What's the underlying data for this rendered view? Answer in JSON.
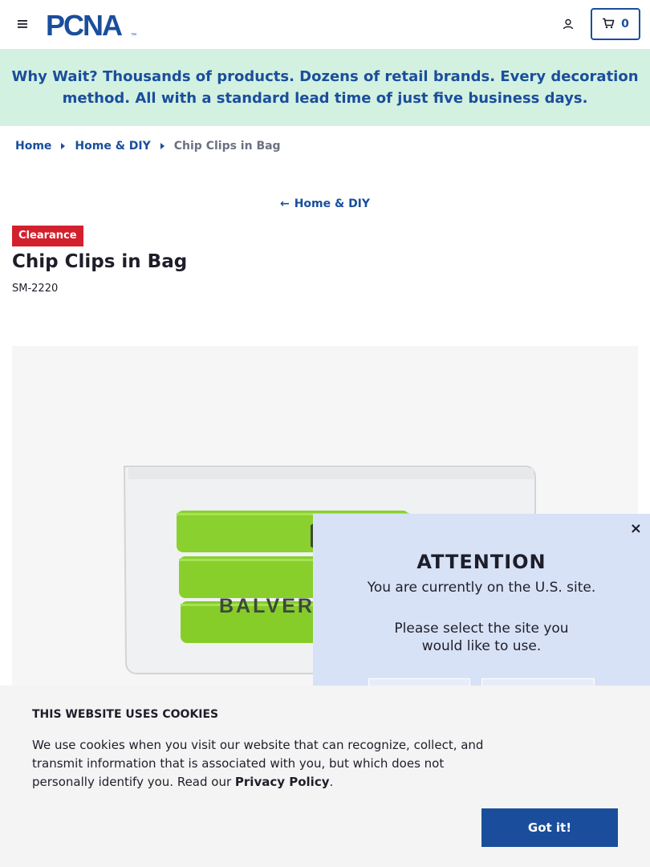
{
  "header": {
    "logo_text": "PCNA",
    "logo_mark": "™",
    "cart_count": "0",
    "brand_color": "#1a4e9c"
  },
  "promo": {
    "text": "Why Wait? Thousands of products. Dozens of retail brands. Every decoration method. All with a standard lead time of just five business days.",
    "background": "#d3f1e1"
  },
  "breadcrumb": [
    {
      "label": "Home"
    },
    {
      "label": "Home & DIY"
    },
    {
      "label": "Chip Clips in Bag"
    }
  ],
  "back_link": {
    "label": "Home & DIY"
  },
  "product": {
    "badge": "Clearance",
    "badge_color": "#d3202d",
    "title": "Chip Clips in Bag",
    "sku": "SM-2220",
    "image_imprint": "BALVER"
  },
  "modal": {
    "close_label": "×",
    "heading": "ATTENTION",
    "text1": "You are currently on the U.S. site.",
    "text2": "Please select the site you would like to use."
  },
  "cookie": {
    "title": "THIS WEBSITE USES COOKIES",
    "text_before": "We use cookies when you visit our website that can recognize, collect, and transmit information that is associated with you, but which does not personally identify you. Read our ",
    "link_label": "Privacy Policy",
    "text_after": ".",
    "button_label": "Got it!"
  }
}
